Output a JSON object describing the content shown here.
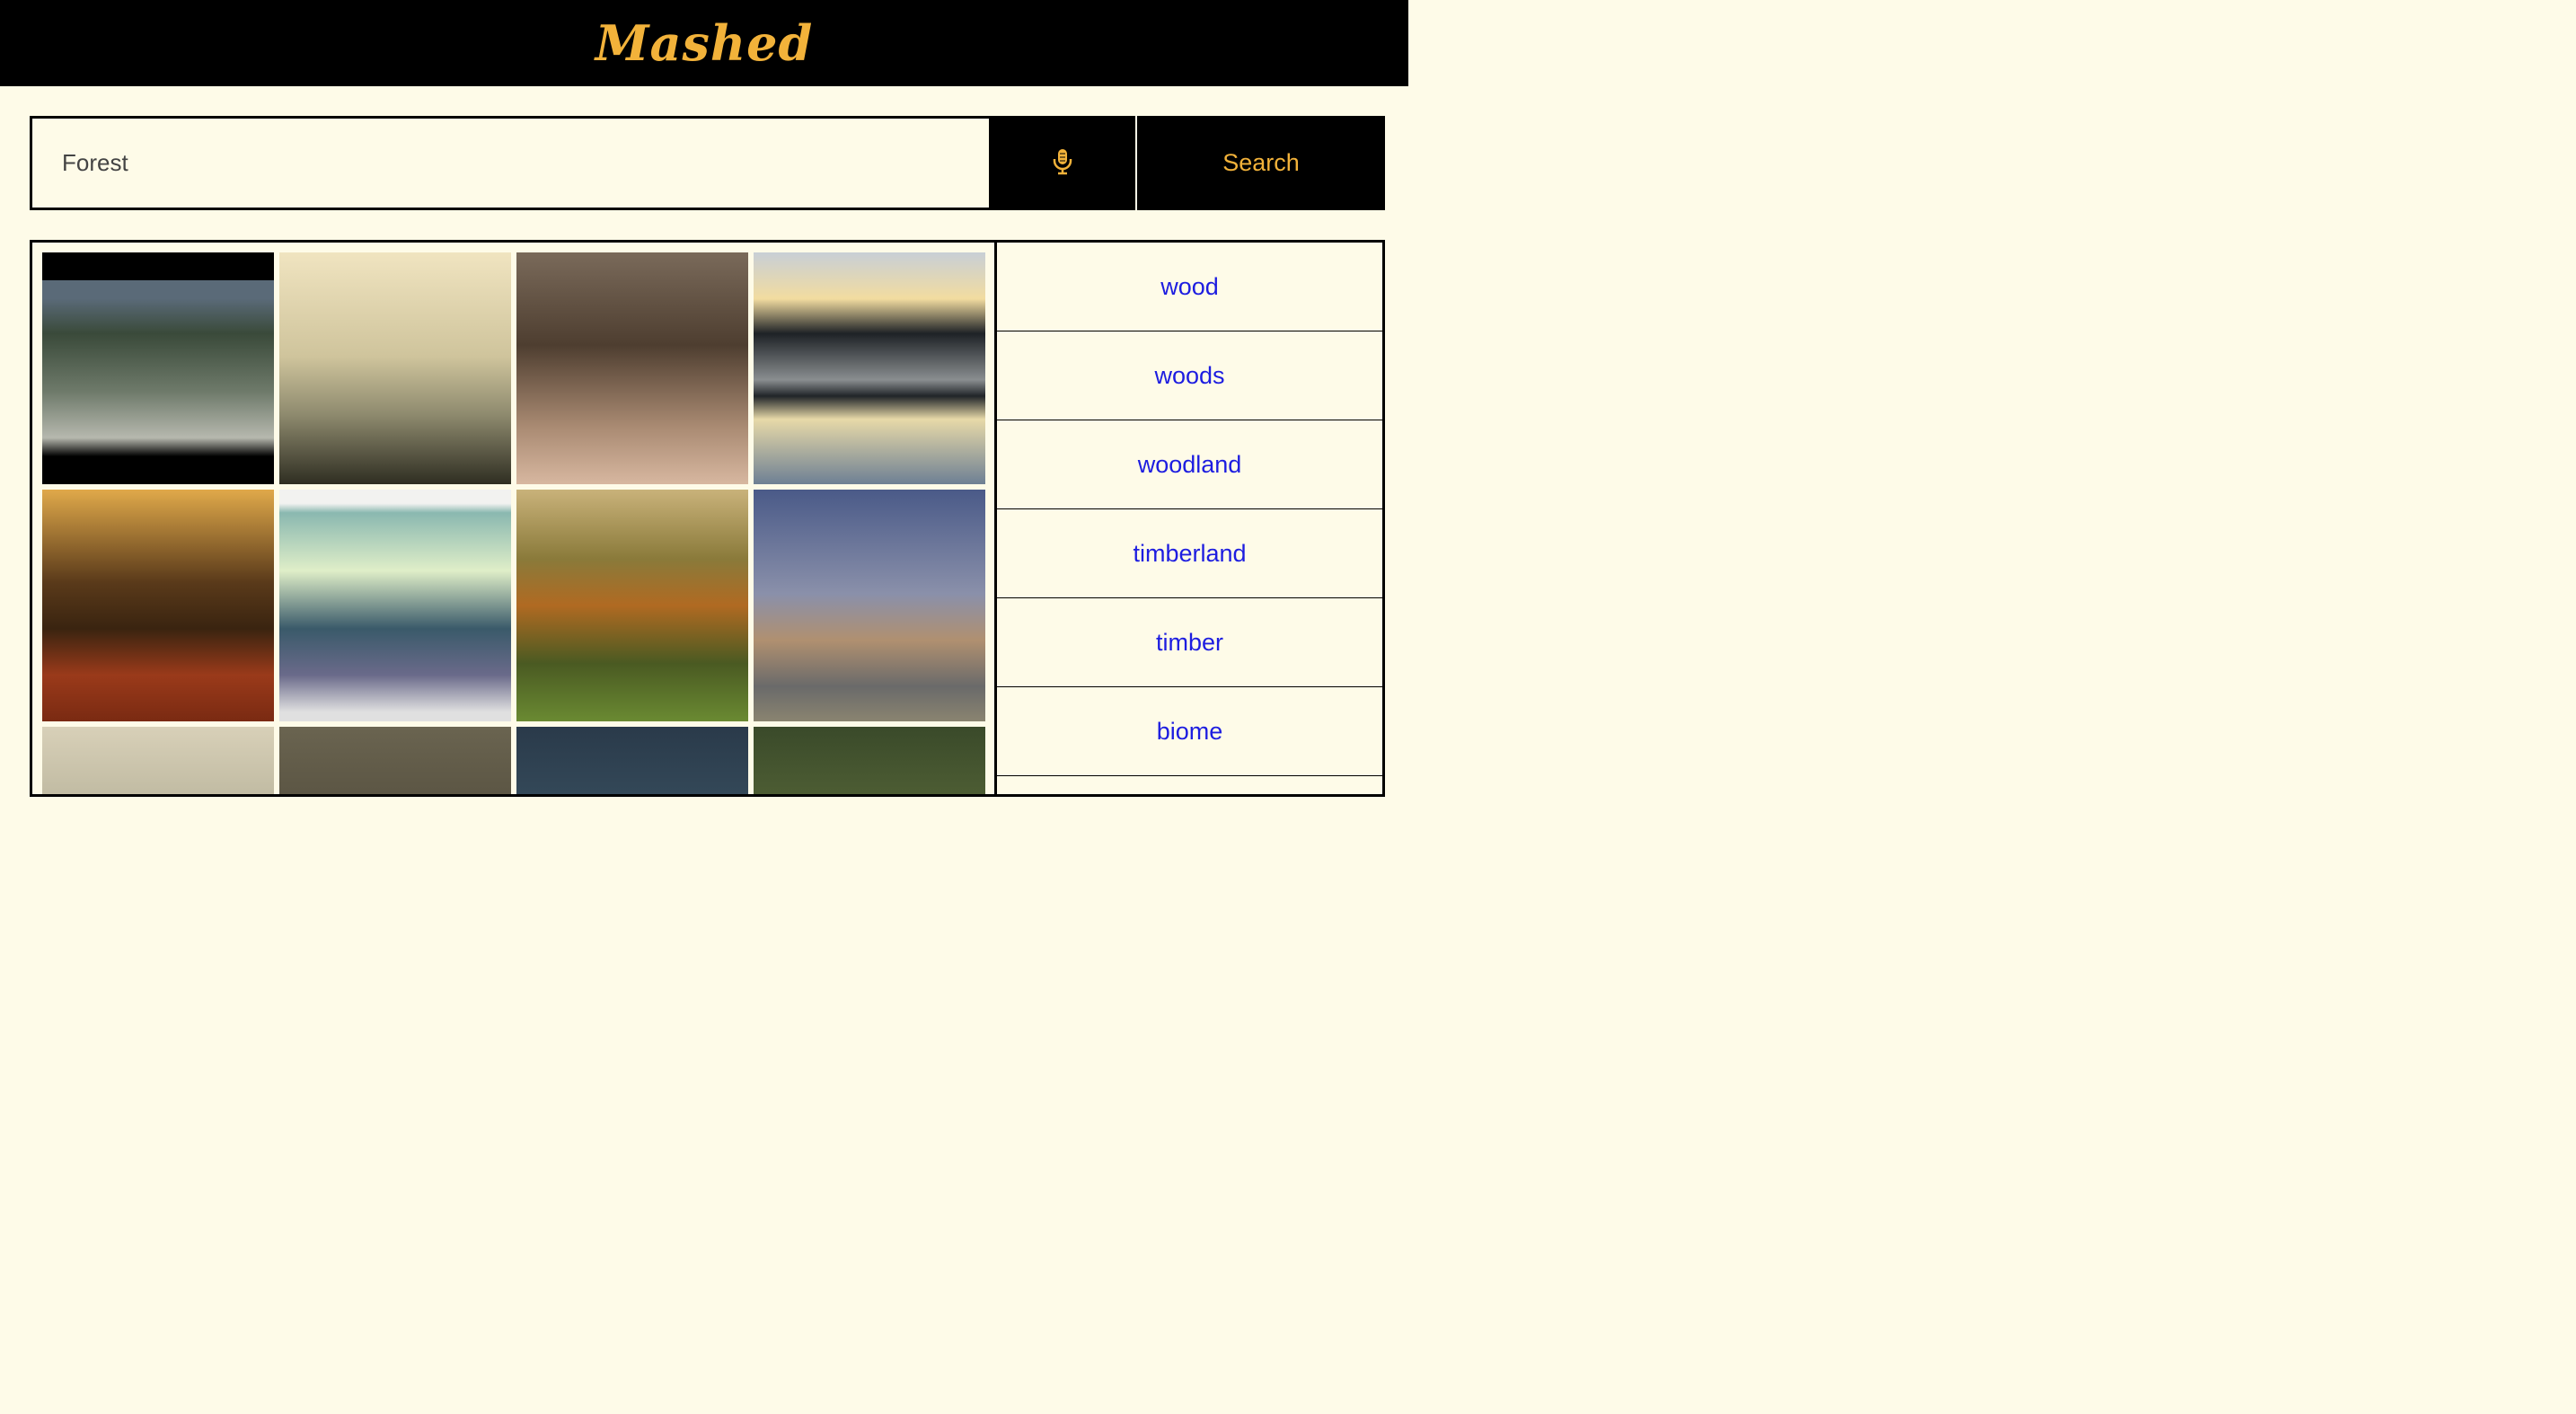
{
  "header": {
    "brand": "Mashed"
  },
  "search": {
    "value": "Forest",
    "button_label": "Search",
    "mic_icon": "microphone-icon"
  },
  "images": [
    {
      "name": "image-tile-1"
    },
    {
      "name": "image-tile-2"
    },
    {
      "name": "image-tile-3"
    },
    {
      "name": "image-tile-4"
    },
    {
      "name": "image-tile-5"
    },
    {
      "name": "image-tile-6"
    },
    {
      "name": "image-tile-7"
    },
    {
      "name": "image-tile-8"
    },
    {
      "name": "image-tile-9"
    },
    {
      "name": "image-tile-10"
    },
    {
      "name": "image-tile-11"
    },
    {
      "name": "image-tile-12"
    }
  ],
  "tags": [
    {
      "label": "wood"
    },
    {
      "label": "woods"
    },
    {
      "label": "woodland"
    },
    {
      "label": "timberland"
    },
    {
      "label": "timber"
    },
    {
      "label": "biome"
    }
  ],
  "colors": {
    "accent": "#f2b23a",
    "background": "#fefbe8",
    "link": "#1d1de0"
  }
}
